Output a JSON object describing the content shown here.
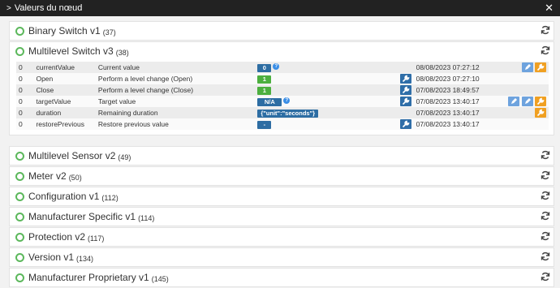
{
  "window": {
    "title": "Valeurs du nœud"
  },
  "classes": [
    {
      "name": "Binary Switch v1",
      "count": "(37)"
    },
    {
      "name": "Multilevel Switch v3",
      "count": "(38)",
      "rows": [
        {
          "instance": "0",
          "name": "currentValue",
          "label": "Current value",
          "value": "0",
          "date": "08/08/2023 07:27:12"
        },
        {
          "instance": "0",
          "name": "Open",
          "label": "Perform a level change (Open)",
          "value": "1",
          "date": "08/08/2023 07:27:10"
        },
        {
          "instance": "0",
          "name": "Close",
          "label": "Perform a level change (Close)",
          "value": "1",
          "date": "07/08/2023 18:49:57"
        },
        {
          "instance": "0",
          "name": "targetValue",
          "label": "Target value",
          "value": "N/A",
          "date": "07/08/2023 13:40:17"
        },
        {
          "instance": "0",
          "name": "duration",
          "label": "Remaining duration",
          "value": "{\"unit\":\"seconds\"}",
          "date": "07/08/2023 13:40:17"
        },
        {
          "instance": "0",
          "name": "restorePrevious",
          "label": "Restore previous value",
          "value": "-",
          "date": "07/08/2023 13:40:17"
        }
      ]
    },
    {
      "name": "Multilevel Sensor v2",
      "count": "(49)"
    },
    {
      "name": "Meter v2",
      "count": "(50)"
    },
    {
      "name": "Configuration v1",
      "count": "(112)"
    },
    {
      "name": "Manufacturer Specific v1",
      "count": "(114)"
    },
    {
      "name": "Protection v2",
      "count": "(117)"
    },
    {
      "name": "Version v1",
      "count": "(134)"
    },
    {
      "name": "Manufacturer Proprietary v1",
      "count": "(145)"
    }
  ],
  "colors": {
    "titlebar": "#222222",
    "ring": "#5cb85c",
    "badge_blue": "#2d6da3",
    "badge_green": "#4caf3f",
    "button_orange": "#f0a022"
  },
  "icons": {
    "close": "close-icon",
    "refresh": "refresh-icon",
    "wrench": "wrench-icon",
    "pencil": "pencil-icon",
    "help": "help-icon"
  }
}
